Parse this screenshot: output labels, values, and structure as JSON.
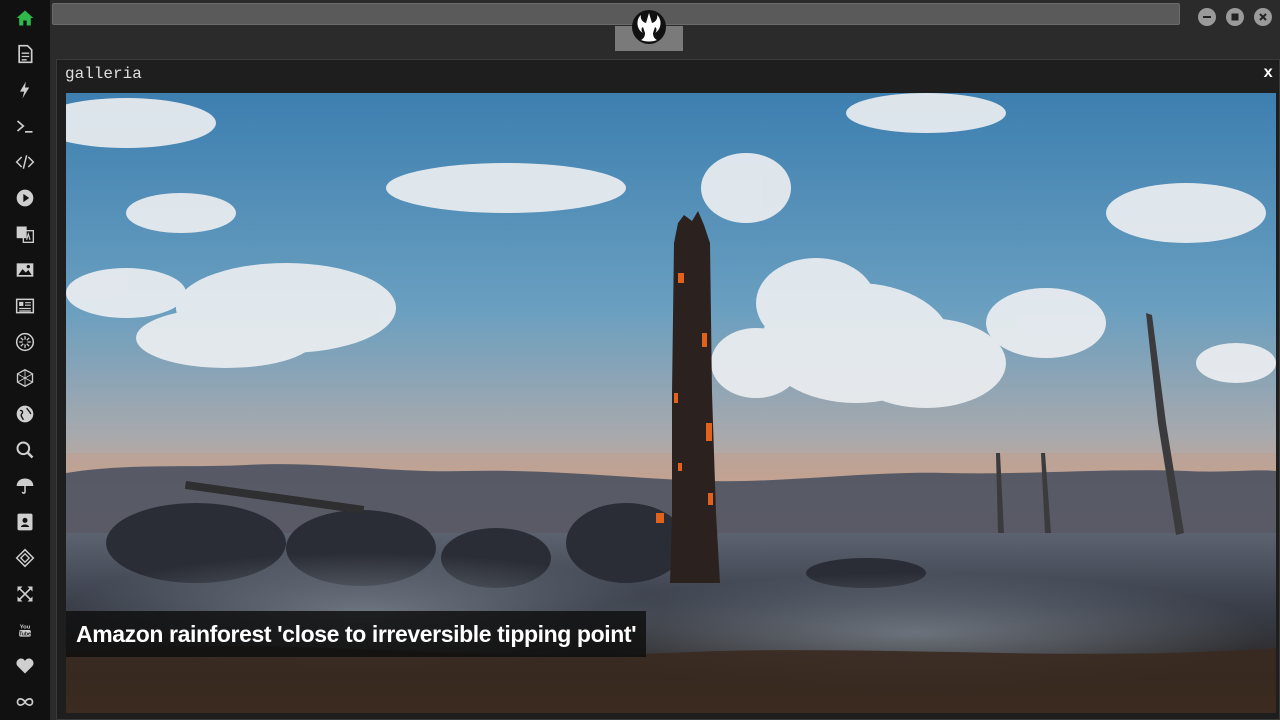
{
  "app": {
    "accent_color": "#2fb84a",
    "sidebar": {
      "icons": [
        "home-icon",
        "document-icon",
        "lightning-icon",
        "terminal-icon",
        "code-icon",
        "play-icon",
        "translate-icon",
        "image-icon",
        "news-icon",
        "cog-circle-icon",
        "hexagon-icon",
        "globe-icon",
        "search-icon",
        "umbrella-icon",
        "contact-card-icon",
        "codepen-icon",
        "expand-icon",
        "youtube-icon",
        "heart-icon",
        "infinity-icon"
      ],
      "active": "home-icon"
    },
    "window_controls": [
      "minimize-icon",
      "maximize-icon",
      "close-icon"
    ]
  },
  "panel": {
    "title": "galleria",
    "close_label": "x"
  },
  "gallery": {
    "caption": "Amazon rainforest 'close to irreversible tipping point'"
  }
}
